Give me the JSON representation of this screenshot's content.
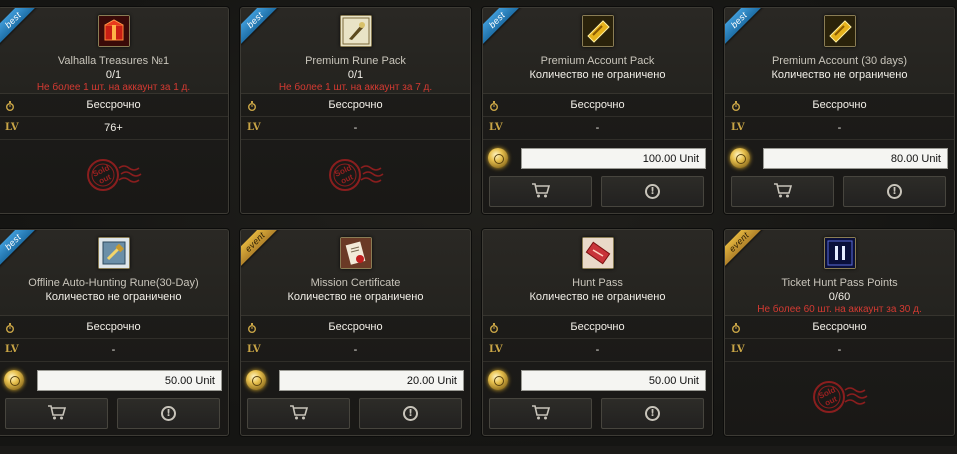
{
  "shop": {
    "items": [
      {
        "ribbon": "best",
        "icon": "red-treasure-box-icon",
        "name": "Valhalla Treasures №1",
        "qty": "0/1",
        "limit": "Не более 1 шт. на аккаунт за 1 д.",
        "duration": "Бессрочно",
        "level": "76+",
        "sold_out": true,
        "price": ""
      },
      {
        "ribbon": "best",
        "icon": "rune-quill-icon",
        "name": "Premium Rune Pack",
        "qty": "0/1",
        "limit": "Не более 1 шт. на аккаунт за 7 д.",
        "duration": "Бессрочно",
        "level": "-",
        "sold_out": true,
        "price": ""
      },
      {
        "ribbon": "best",
        "icon": "gold-ticket-icon",
        "name": "Premium Account Pack",
        "qty": "Количество не ограничено",
        "limit": "",
        "duration": "Бессрочно",
        "level": "-",
        "sold_out": false,
        "price": "100.00 Unit"
      },
      {
        "ribbon": "best",
        "icon": "gold-ticket-icon",
        "name": "Premium Account (30 days)",
        "qty": "Количество не ограничено",
        "limit": "",
        "duration": "Бессрочно",
        "level": "-",
        "sold_out": false,
        "price": "80.00 Unit"
      },
      {
        "ribbon": "best",
        "icon": "hammer-rune-icon",
        "name": "Offline Auto-Hunting Rune(30-Day)",
        "qty": "Количество не ограничено",
        "limit": "",
        "duration": "Бессрочно",
        "level": "-",
        "sold_out": false,
        "price": "50.00 Unit"
      },
      {
        "ribbon": "event",
        "icon": "scroll-certificate-icon",
        "name": "Mission Certificate",
        "qty": "Количество не ограничено",
        "limit": "",
        "duration": "Бессрочно",
        "level": "-",
        "sold_out": false,
        "price": "20.00 Unit"
      },
      {
        "ribbon": "",
        "icon": "red-pass-ticket-icon",
        "name": "Hunt Pass",
        "qty": "Количество не ограничено",
        "limit": "",
        "duration": "Бессрочно",
        "level": "-",
        "sold_out": false,
        "price": "50.00 Unit"
      },
      {
        "ribbon": "event",
        "icon": "blue-pass-icon",
        "name": "Ticket Hunt Pass Points",
        "qty": "0/60",
        "limit": "Не более 60 шт. на аккаунт за 30 д.",
        "duration": "Бессрочно",
        "level": "-",
        "sold_out": true,
        "price": ""
      }
    ],
    "level_tag": "LV",
    "sold_out_label": "Sold out"
  },
  "colors": {
    "limit_red": "#d43a32",
    "best_ribbon": "#2f86c3",
    "event_ribbon": "#d3a33a",
    "coin_gold": "#e8c14e"
  }
}
